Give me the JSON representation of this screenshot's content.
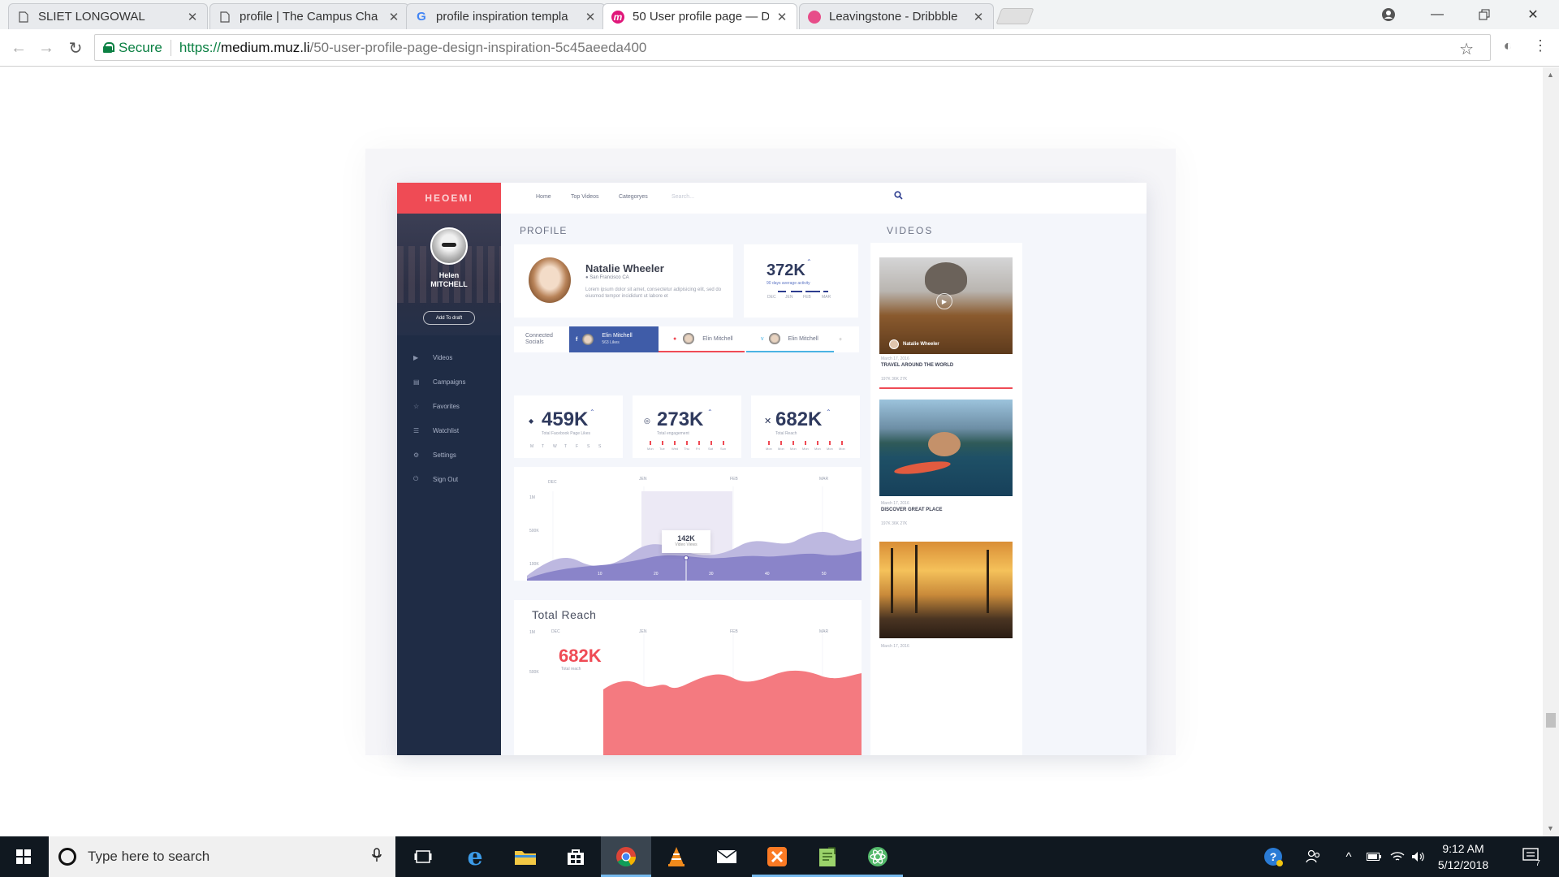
{
  "browser": {
    "tabs": [
      {
        "title": "SLIET LONGOWAL",
        "icon": "document-icon"
      },
      {
        "title": "profile | The Campus Cha",
        "icon": "document-icon"
      },
      {
        "title": "profile inspiration templa",
        "icon": "google-icon"
      },
      {
        "title": "50 User profile page — D",
        "icon": "muzli-icon"
      },
      {
        "title": "Leavingstone - Dribbble",
        "icon": "dribbble-icon"
      }
    ],
    "active_tab": 3,
    "secure_label": "Secure",
    "url_scheme": "https://",
    "url_host": "medium.muz.li",
    "url_path": "/50-user-profile-page-design-inspiration-5c45aeeda400"
  },
  "dashboard": {
    "logo_text": "HEOEMI",
    "sidebar": {
      "name_line1": "Helen",
      "name_line2": "MITCHELL",
      "button": "Add To draft",
      "items": [
        {
          "label": "Videos",
          "icon": "play-icon"
        },
        {
          "label": "Campaigns",
          "icon": "campaign-icon"
        },
        {
          "label": "Favorites",
          "icon": "star-icon"
        },
        {
          "label": "Watchlist",
          "icon": "list-icon"
        },
        {
          "label": "Settings",
          "icon": "gear-icon"
        },
        {
          "label": "Sign Out",
          "icon": "power-icon"
        }
      ]
    },
    "nav": {
      "home": "Home",
      "top_videos": "Top Videos",
      "categories": "Categoryes",
      "search_placeholder": "Search..."
    },
    "profile_heading": "PROFILE",
    "videos_heading": "VIDEOS",
    "profile": {
      "name": "Natalie Wheeler",
      "location": "San Francisco CA",
      "bio": "Lorem ipsum dolor sit amet, consectetur adipisicing elit, sed do eiusmod tempor incididunt ut labore et"
    },
    "activity": {
      "value": "372K",
      "label": "90 days average activity",
      "months": [
        "DEC",
        "JEN",
        "FEB",
        "MAR"
      ]
    },
    "socials": {
      "label_line1": "Connected",
      "label_line2": "Socials",
      "accounts": [
        {
          "name": "Elin Mitchell",
          "sub": "563 Likes",
          "network": "facebook"
        },
        {
          "name": "Elin Mitchell",
          "network": "instagram"
        },
        {
          "name": "Elin Mitchell",
          "network": "vimeo"
        }
      ],
      "add": "+"
    },
    "stats": [
      {
        "value": "459K",
        "label": "Total Facebook Page Likes",
        "icon": "drop-icon",
        "days": [
          "M",
          "T",
          "W",
          "T",
          "F",
          "S",
          "S"
        ]
      },
      {
        "value": "273K",
        "label": "Total engagement",
        "icon": "target-icon",
        "days": [
          "Mon",
          "Tue",
          "Wed",
          "Thu",
          "Fri",
          "Sat",
          "Sun"
        ]
      },
      {
        "value": "682K",
        "label": "Total Reach",
        "icon": "cross-icon",
        "days": [
          "Mon",
          "Mon",
          "Mon",
          "Mon",
          "Mon",
          "Mon",
          "Mon"
        ]
      }
    ],
    "views_chart": {
      "months": [
        "DEC",
        "JEN",
        "FEB",
        "MAR"
      ],
      "y_ticks": [
        "1M",
        "500K",
        "100K"
      ],
      "x_ticks": [
        "10",
        "20",
        "30",
        "40",
        "50"
      ],
      "tooltip_value": "142K",
      "tooltip_label": "Video Views"
    },
    "reach": {
      "title": "Total Reach",
      "value": "682K",
      "label": "Total reach",
      "months": [
        "DEC",
        "JEN",
        "FEB",
        "MAR"
      ],
      "y_ticks": [
        "1M",
        "500K"
      ]
    },
    "videos": [
      {
        "author": "Natalie Wheeler",
        "date": "March 17, 2016",
        "title": "TRAVEL AROUND THE WORLD",
        "meta": "197K   36K   27K"
      },
      {
        "date": "March 17, 2016",
        "title": "DISCOVER GREAT PLACE",
        "meta": "197K   36K   27K"
      },
      {
        "date": "March 17, 2016"
      }
    ]
  },
  "taskbar": {
    "search_placeholder": "Type here to search",
    "time": "9:12 AM",
    "date": "5/12/2018",
    "notification_count": "7"
  },
  "colors": {
    "accent_red": "#ef4b55",
    "sidebar_navy": "#1f2c45",
    "chart_purple": "#8a84c9",
    "facebook_blue": "#3f5ca8"
  }
}
